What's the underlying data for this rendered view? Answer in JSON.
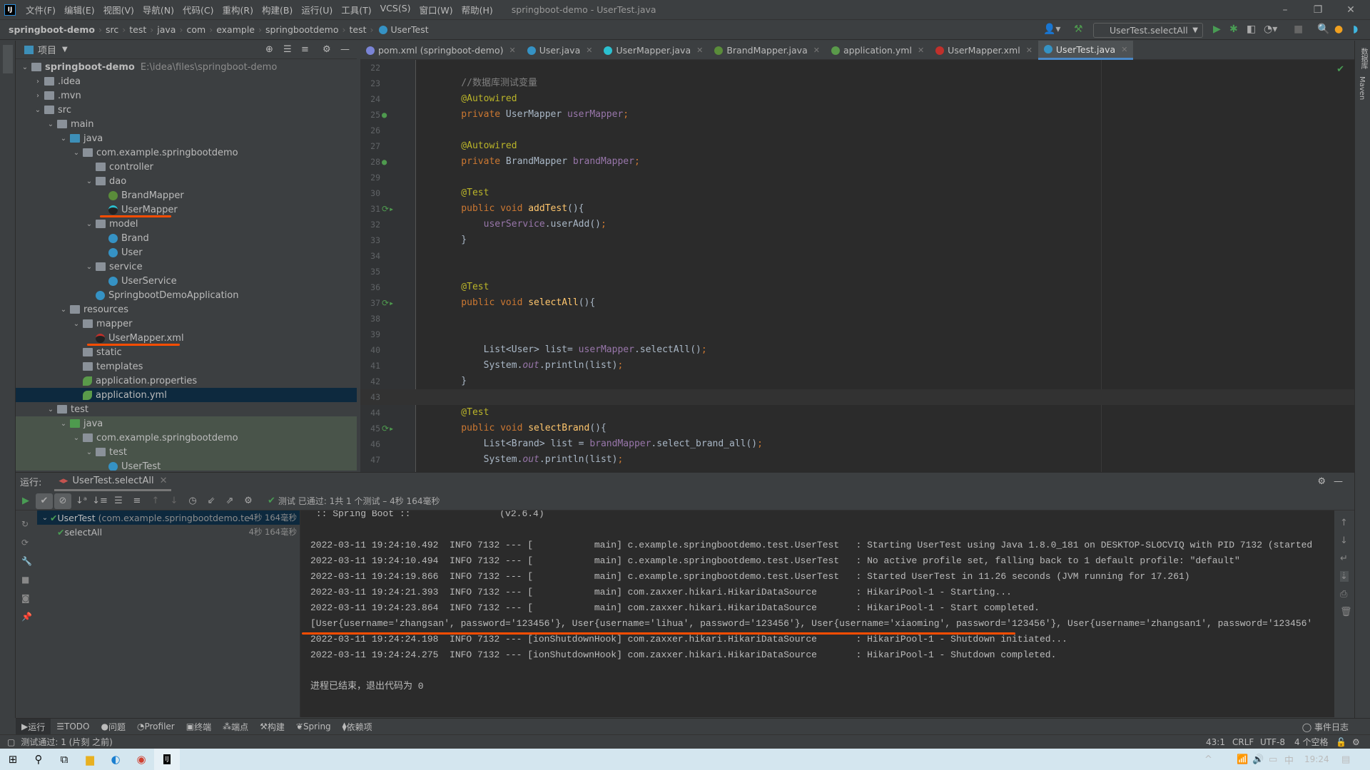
{
  "app": {
    "window_title": "springboot-demo - UserTest.java",
    "menu": [
      "文件(F)",
      "编辑(E)",
      "视图(V)",
      "导航(N)",
      "代码(C)",
      "重构(R)",
      "构建(B)",
      "运行(U)",
      "工具(T)",
      "VCS(S)",
      "窗口(W)",
      "帮助(H)"
    ],
    "logo": "IJ"
  },
  "breadcrumb": [
    "springboot-demo",
    "src",
    "test",
    "java",
    "com",
    "example",
    "springbootdemo",
    "test",
    "UserTest"
  ],
  "toolbar": {
    "run_config": "UserTest.selectAll"
  },
  "project_panel": {
    "title": "项目",
    "root_path": "E:\\idea\\files\\springboot-demo",
    "items": [
      {
        "label": "springboot-demo",
        "level": 0,
        "expanded": true,
        "icon": "module-folder",
        "bold": true
      },
      {
        "label": ".idea",
        "level": 1,
        "expanded": false,
        "icon": "folder"
      },
      {
        "label": ".mvn",
        "level": 1,
        "expanded": false,
        "icon": "folder"
      },
      {
        "label": "src",
        "level": 1,
        "expanded": true,
        "icon": "folder"
      },
      {
        "label": "main",
        "level": 2,
        "expanded": true,
        "icon": "folder"
      },
      {
        "label": "java",
        "level": 3,
        "expanded": true,
        "icon": "source-folder"
      },
      {
        "label": "com.example.springbootdemo",
        "level": 4,
        "expanded": true,
        "icon": "package"
      },
      {
        "label": "controller",
        "level": 5,
        "icon": "package"
      },
      {
        "label": "dao",
        "level": 5,
        "expanded": true,
        "icon": "package"
      },
      {
        "label": "BrandMapper",
        "level": 6,
        "icon": "interface"
      },
      {
        "label": "UserMapper",
        "level": 6,
        "icon": "mybatis-mapper",
        "underlined": true
      },
      {
        "label": "model",
        "level": 5,
        "expanded": true,
        "icon": "package"
      },
      {
        "label": "Brand",
        "level": 6,
        "icon": "class"
      },
      {
        "label": "User",
        "level": 6,
        "icon": "class"
      },
      {
        "label": "service",
        "level": 5,
        "expanded": true,
        "icon": "package"
      },
      {
        "label": "UserService",
        "level": 6,
        "icon": "class"
      },
      {
        "label": "SpringbootDemoApplication",
        "level": 5,
        "icon": "spring-class"
      },
      {
        "label": "resources",
        "level": 3,
        "expanded": true,
        "icon": "resources-folder"
      },
      {
        "label": "mapper",
        "level": 4,
        "expanded": true,
        "icon": "folder"
      },
      {
        "label": "UserMapper.xml",
        "level": 5,
        "icon": "mybatis-xml",
        "underlined": true
      },
      {
        "label": "static",
        "level": 4,
        "icon": "folder"
      },
      {
        "label": "templates",
        "level": 4,
        "icon": "folder"
      },
      {
        "label": "application.properties",
        "level": 4,
        "icon": "spring-config"
      },
      {
        "label": "application.yml",
        "level": 4,
        "icon": "spring-config",
        "selected": true
      },
      {
        "label": "test",
        "level": 2,
        "expanded": true,
        "icon": "folder"
      },
      {
        "label": "java",
        "level": 3,
        "expanded": true,
        "icon": "test-folder",
        "test": true
      },
      {
        "label": "com.example.springbootdemo",
        "level": 4,
        "expanded": true,
        "icon": "package",
        "test": true
      },
      {
        "label": "test",
        "level": 5,
        "expanded": true,
        "icon": "package",
        "test": true
      },
      {
        "label": "UserTest",
        "level": 6,
        "icon": "test-class",
        "test": true
      }
    ]
  },
  "editor_tabs": [
    {
      "label": "pom.xml (springboot-demo)",
      "icon": "maven",
      "color": "#7a84d6"
    },
    {
      "label": "User.java",
      "icon": "class",
      "color": "#3592c4"
    },
    {
      "label": "UserMapper.java",
      "icon": "mybatis-mapper",
      "color": "#2bc0d0"
    },
    {
      "label": "BrandMapper.java",
      "icon": "interface",
      "color": "#5a8c3a"
    },
    {
      "label": "application.yml",
      "icon": "spring-config",
      "color": "#5a9a4a"
    },
    {
      "label": "UserMapper.xml",
      "icon": "mybatis-xml",
      "color": "#c0302b"
    },
    {
      "label": "UserTest.java",
      "icon": "test-class",
      "color": "#3592c4",
      "active": true
    }
  ],
  "editor": {
    "current_line": 43,
    "lines": [
      {
        "n": 22,
        "t": []
      },
      {
        "n": 23,
        "t": [
          [
            "    //数据库测试变量",
            "cmt"
          ]
        ]
      },
      {
        "n": 24,
        "t": [
          [
            "    @Autowired",
            "ann"
          ]
        ]
      },
      {
        "n": 25,
        "t": [
          [
            "    private ",
            "kw"
          ],
          [
            "UserMapper ",
            ""
          ],
          [
            "userMapper",
            "fld"
          ],
          [
            ";",
            "kw"
          ]
        ],
        "g": "bean-icon"
      },
      {
        "n": 26,
        "t": []
      },
      {
        "n": 27,
        "t": [
          [
            "    @Autowired",
            "ann"
          ]
        ]
      },
      {
        "n": 28,
        "t": [
          [
            "    private ",
            "kw"
          ],
          [
            "BrandMapper ",
            ""
          ],
          [
            "brandMapper",
            "fld"
          ],
          [
            ";",
            "kw"
          ]
        ],
        "g": "bean-icon"
      },
      {
        "n": 29,
        "t": []
      },
      {
        "n": 30,
        "t": [
          [
            "    @Test",
            "ann"
          ]
        ]
      },
      {
        "n": 31,
        "t": [
          [
            "    public void ",
            "kw"
          ],
          [
            "addTest",
            "fn"
          ],
          [
            "(){",
            ""
          ]
        ],
        "g": "run-test-icon"
      },
      {
        "n": 32,
        "t": [
          [
            "        userService",
            "fld"
          ],
          [
            ".userAdd()",
            ""
          ],
          [
            ";",
            "kw"
          ]
        ]
      },
      {
        "n": 33,
        "t": [
          [
            "    }",
            ""
          ]
        ]
      },
      {
        "n": 34,
        "t": []
      },
      {
        "n": 35,
        "t": []
      },
      {
        "n": 36,
        "t": [
          [
            "    @Test",
            "ann"
          ]
        ]
      },
      {
        "n": 37,
        "t": [
          [
            "    public void ",
            "kw"
          ],
          [
            "selectAll",
            "fn"
          ],
          [
            "(){",
            ""
          ]
        ],
        "g": "run-test-icon"
      },
      {
        "n": 38,
        "t": []
      },
      {
        "n": 39,
        "t": []
      },
      {
        "n": 40,
        "t": [
          [
            "        List<User> list= ",
            ""
          ],
          [
            "userMapper",
            "fld"
          ],
          [
            ".selectAll()",
            ""
          ],
          [
            ";",
            "kw"
          ]
        ]
      },
      {
        "n": 41,
        "t": [
          [
            "        System.",
            ""
          ],
          [
            "out",
            "st"
          ],
          [
            ".println(list)",
            ""
          ],
          [
            ";",
            "kw"
          ]
        ]
      },
      {
        "n": 42,
        "t": [
          [
            "    }",
            ""
          ]
        ]
      },
      {
        "n": 43,
        "t": []
      },
      {
        "n": 44,
        "t": [
          [
            "    @Test",
            "ann"
          ]
        ]
      },
      {
        "n": 45,
        "t": [
          [
            "    public void ",
            "kw"
          ],
          [
            "selectBrand",
            "fn"
          ],
          [
            "(){",
            ""
          ]
        ],
        "g": "run-test-icon"
      },
      {
        "n": 46,
        "t": [
          [
            "        List<Brand> list = ",
            ""
          ],
          [
            "brandMapper",
            "fld"
          ],
          [
            ".select_brand_all()",
            ""
          ],
          [
            ";",
            "kw"
          ]
        ]
      },
      {
        "n": 47,
        "t": [
          [
            "        System.",
            ""
          ],
          [
            "out",
            "st"
          ],
          [
            ".println(list)",
            ""
          ],
          [
            ";",
            "kw"
          ]
        ]
      }
    ]
  },
  "run_panel": {
    "label": "运行:",
    "tab": "UserTest.selectAll",
    "status": "测试 已通过: 1共 1 个测试 – 4秒 164毫秒",
    "tree": [
      {
        "label": "UserTest",
        "detail": "(com.example.springbootdemo.test",
        "time": "4秒 164毫秒",
        "selected": true
      },
      {
        "label": "selectAll",
        "time": "4秒 164毫秒"
      }
    ],
    "console": [
      " :: Spring Boot ::                (v2.6.4)",
      "",
      "2022-03-11 19:24:10.492  INFO 7132 --- [           main] c.example.springbootdemo.test.UserTest   : Starting UserTest using Java 1.8.0_181 on DESKTOP-SLOCVIQ with PID 7132 (started",
      "2022-03-11 19:24:10.494  INFO 7132 --- [           main] c.example.springbootdemo.test.UserTest   : No active profile set, falling back to 1 default profile: \"default\"",
      "2022-03-11 19:24:19.866  INFO 7132 --- [           main] c.example.springbootdemo.test.UserTest   : Started UserTest in 11.26 seconds (JVM running for 17.261)",
      "2022-03-11 19:24:21.393  INFO 7132 --- [           main] com.zaxxer.hikari.HikariDataSource       : HikariPool-1 - Starting...",
      "2022-03-11 19:24:23.864  INFO 7132 --- [           main] com.zaxxer.hikari.HikariDataSource       : HikariPool-1 - Start completed.",
      "[User{username='zhangsan', password='123456'}, User{username='lihua', password='123456'}, User{username='xiaoming', password='123456'}, User{username='zhangsan1', password='123456'",
      "2022-03-11 19:24:24.198  INFO 7132 --- [ionShutdownHook] com.zaxxer.hikari.HikariDataSource       : HikariPool-1 - Shutdown initiated...",
      "2022-03-11 19:24:24.275  INFO 7132 --- [ionShutdownHook] com.zaxxer.hikari.HikariDataSource       : HikariPool-1 - Shutdown completed.",
      "",
      "进程已结束，退出代码为 0"
    ]
  },
  "bottom_tabs": [
    "运行",
    "TODO",
    "问题",
    "Profiler",
    "终端",
    "端点",
    "构建",
    "Spring",
    "依赖项"
  ],
  "event_log": "事件日志",
  "status_bar": {
    "message": "测试通过: 1 (片刻 之前)",
    "position": "43:1",
    "line_sep": "CRLF",
    "encoding": "UTF-8",
    "indent": "4 个空格"
  },
  "taskbar": {
    "ime": "中",
    "time": "19:24"
  },
  "right_strip": [
    "数据库",
    "Maven"
  ],
  "colors": {
    "accent": "#4a88c7",
    "highlight_underline": "#ff4d00",
    "pass": "#499c54"
  }
}
